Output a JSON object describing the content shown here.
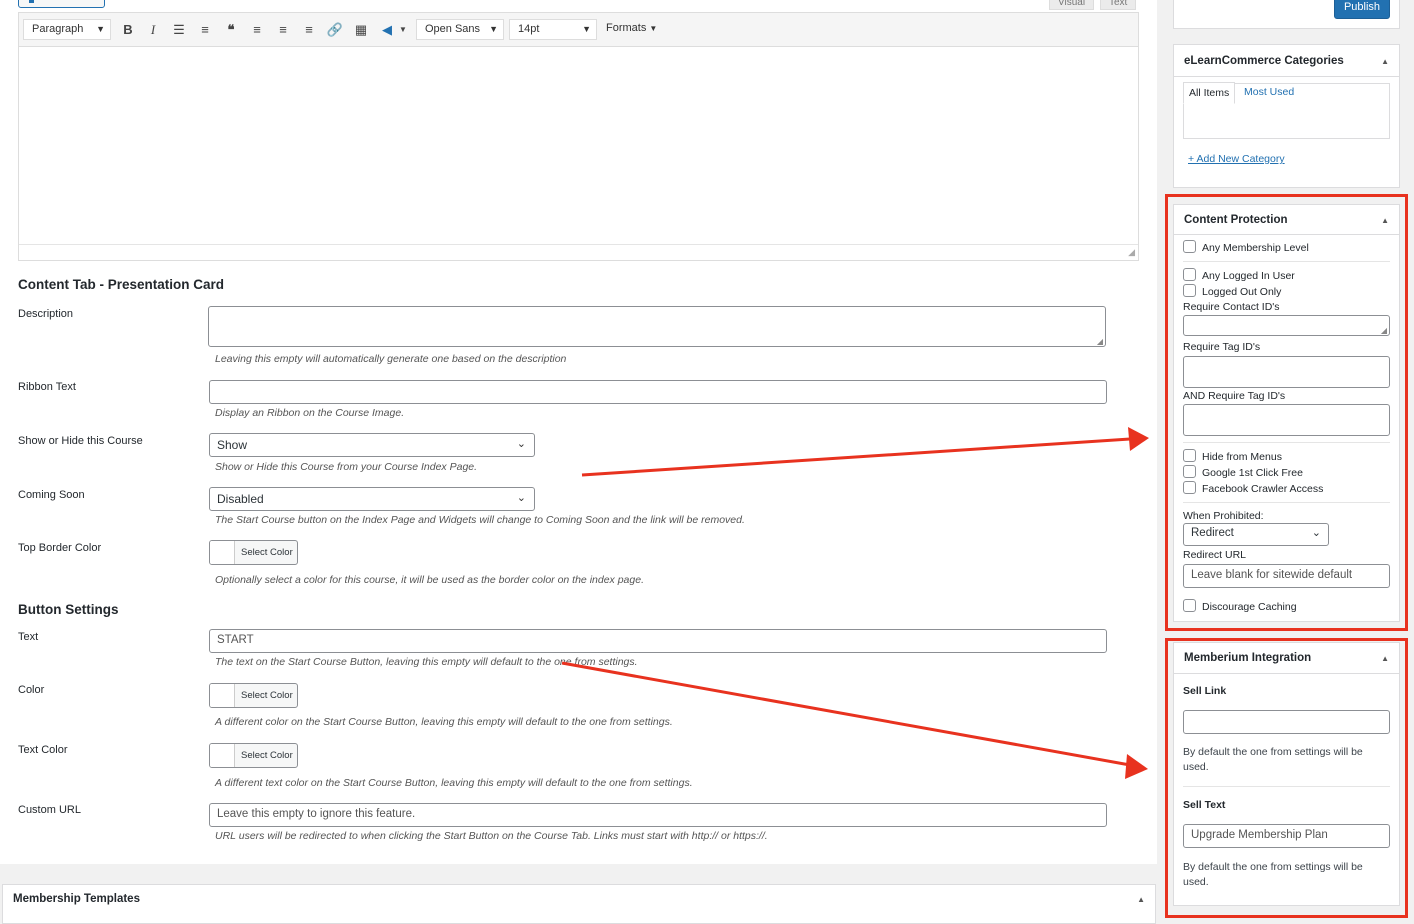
{
  "editor": {
    "paragraph_select": "Paragraph",
    "font_select": "Open Sans",
    "size_select": "14pt",
    "formats_label": "Formats",
    "visual_tab": "Visual",
    "text_tab": "Text"
  },
  "presentation": {
    "title": "Content Tab - Presentation Card",
    "description_label": "Description",
    "description_hint": "Leaving this empty will automatically generate one based on the description",
    "ribbon_label": "Ribbon Text",
    "ribbon_hint": "Display an Ribbon on the Course Image.",
    "show_hide_label": "Show or Hide this Course",
    "show_hide_value": "Show",
    "show_hide_hint": "Show or Hide this Course from your Course Index Page.",
    "coming_soon_label": "Coming Soon",
    "coming_soon_value": "Disabled",
    "coming_soon_hint": "The Start Course button on the Index Page and Widgets will change to Coming Soon and the link will be removed.",
    "border_color_label": "Top Border Color",
    "border_color_btn": "Select Color",
    "border_color_hint": "Optionally select a color for this course, it will be used as the border color on the index page."
  },
  "button_settings": {
    "title": "Button Settings",
    "text_label": "Text",
    "text_value": "START",
    "text_hint": "The text on the Start Course Button, leaving this empty will default to the one from settings.",
    "color_label": "Color",
    "color_btn": "Select Color",
    "color_hint": "A different color on the Start Course Button, leaving this empty will default to the one from settings.",
    "text_color_label": "Text Color",
    "text_color_btn": "Select Color",
    "text_color_hint": "A different text color on the Start Course Button, leaving this empty will default to the one from settings.",
    "custom_url_label": "Custom URL",
    "custom_url_placeholder": "Leave this empty to ignore this feature.",
    "custom_url_hint": "URL users will be redirected to when clicking the Start Button on the Course Tab. Links must start with http:// or https://."
  },
  "membership_templates": {
    "title": "Membership Templates"
  },
  "sidebar": {
    "publish_label": "Publish",
    "categories": {
      "title": "eLearnCommerce Categories",
      "tab_all": "All Items",
      "tab_most_used": "Most Used",
      "add_new": "+ Add New Category"
    },
    "content_protection": {
      "title": "Content Protection",
      "any_membership": "Any Membership Level",
      "any_logged_in": "Any Logged In User",
      "logged_out_only": "Logged Out Only",
      "require_contact_ids": "Require Contact ID's",
      "require_tag_ids": "Require Tag ID's",
      "and_require_tag_ids": "AND Require Tag ID's",
      "hide_menus": "Hide from Menus",
      "google_click": "Google 1st Click Free",
      "facebook_crawler": "Facebook Crawler Access",
      "when_prohibited": "When Prohibited:",
      "when_prohibited_value": "Redirect",
      "redirect_url_label": "Redirect URL",
      "redirect_url_placeholder": "Leave blank for sitewide default",
      "discourage_caching": "Discourage Caching"
    },
    "memberium": {
      "title": "Memberium Integration",
      "sell_link_label": "Sell Link",
      "sell_link_help": "By default the one from settings will be used.",
      "sell_text_label": "Sell Text",
      "sell_text_placeholder": "Upgrade Membership Plan",
      "sell_text_help": "By default the one from settings will be used."
    }
  },
  "colors": {
    "highlight": "#e8321f",
    "accent": "#2271b1"
  }
}
